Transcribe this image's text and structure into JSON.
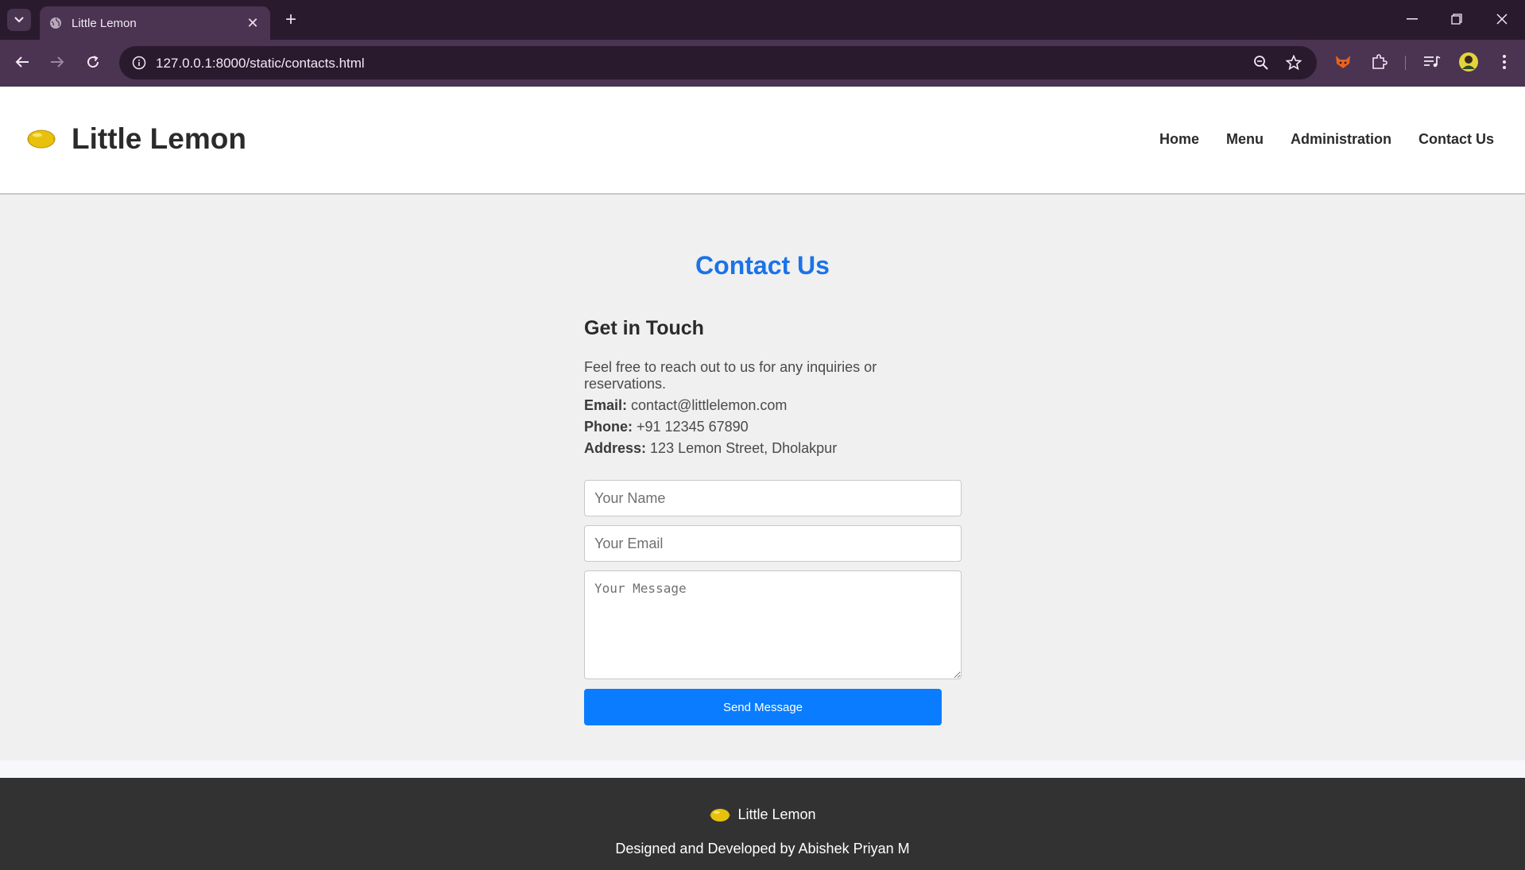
{
  "browser": {
    "tab_title": "Little Lemon",
    "url": "127.0.0.1:8000/static/contacts.html"
  },
  "header": {
    "logo_text": "Little Lemon",
    "nav": [
      "Home",
      "Menu",
      "Administration",
      "Contact Us"
    ]
  },
  "main": {
    "title": "Contact Us",
    "subtitle": "Get in Touch",
    "intro": "Feel free to reach out to us for any inquiries or reservations.",
    "email_label": "Email:",
    "email_value": "contact@littlelemon.com",
    "phone_label": "Phone:",
    "phone_value": "+91 12345 67890",
    "address_label": "Address:",
    "address_value": "123 Lemon Street, Dholakpur"
  },
  "form": {
    "name_placeholder": "Your Name",
    "email_placeholder": "Your Email",
    "message_placeholder": "Your Message",
    "submit_label": "Send Message"
  },
  "footer": {
    "logo_text": "Little Lemon",
    "credit": "Designed and Developed by Abishek Priyan M"
  },
  "icons": {
    "lemon": "lemon-icon",
    "globe": "globe-icon"
  },
  "colors": {
    "accent": "#0a7cff",
    "title": "#1a73e8",
    "chrome": "#4b3352"
  }
}
